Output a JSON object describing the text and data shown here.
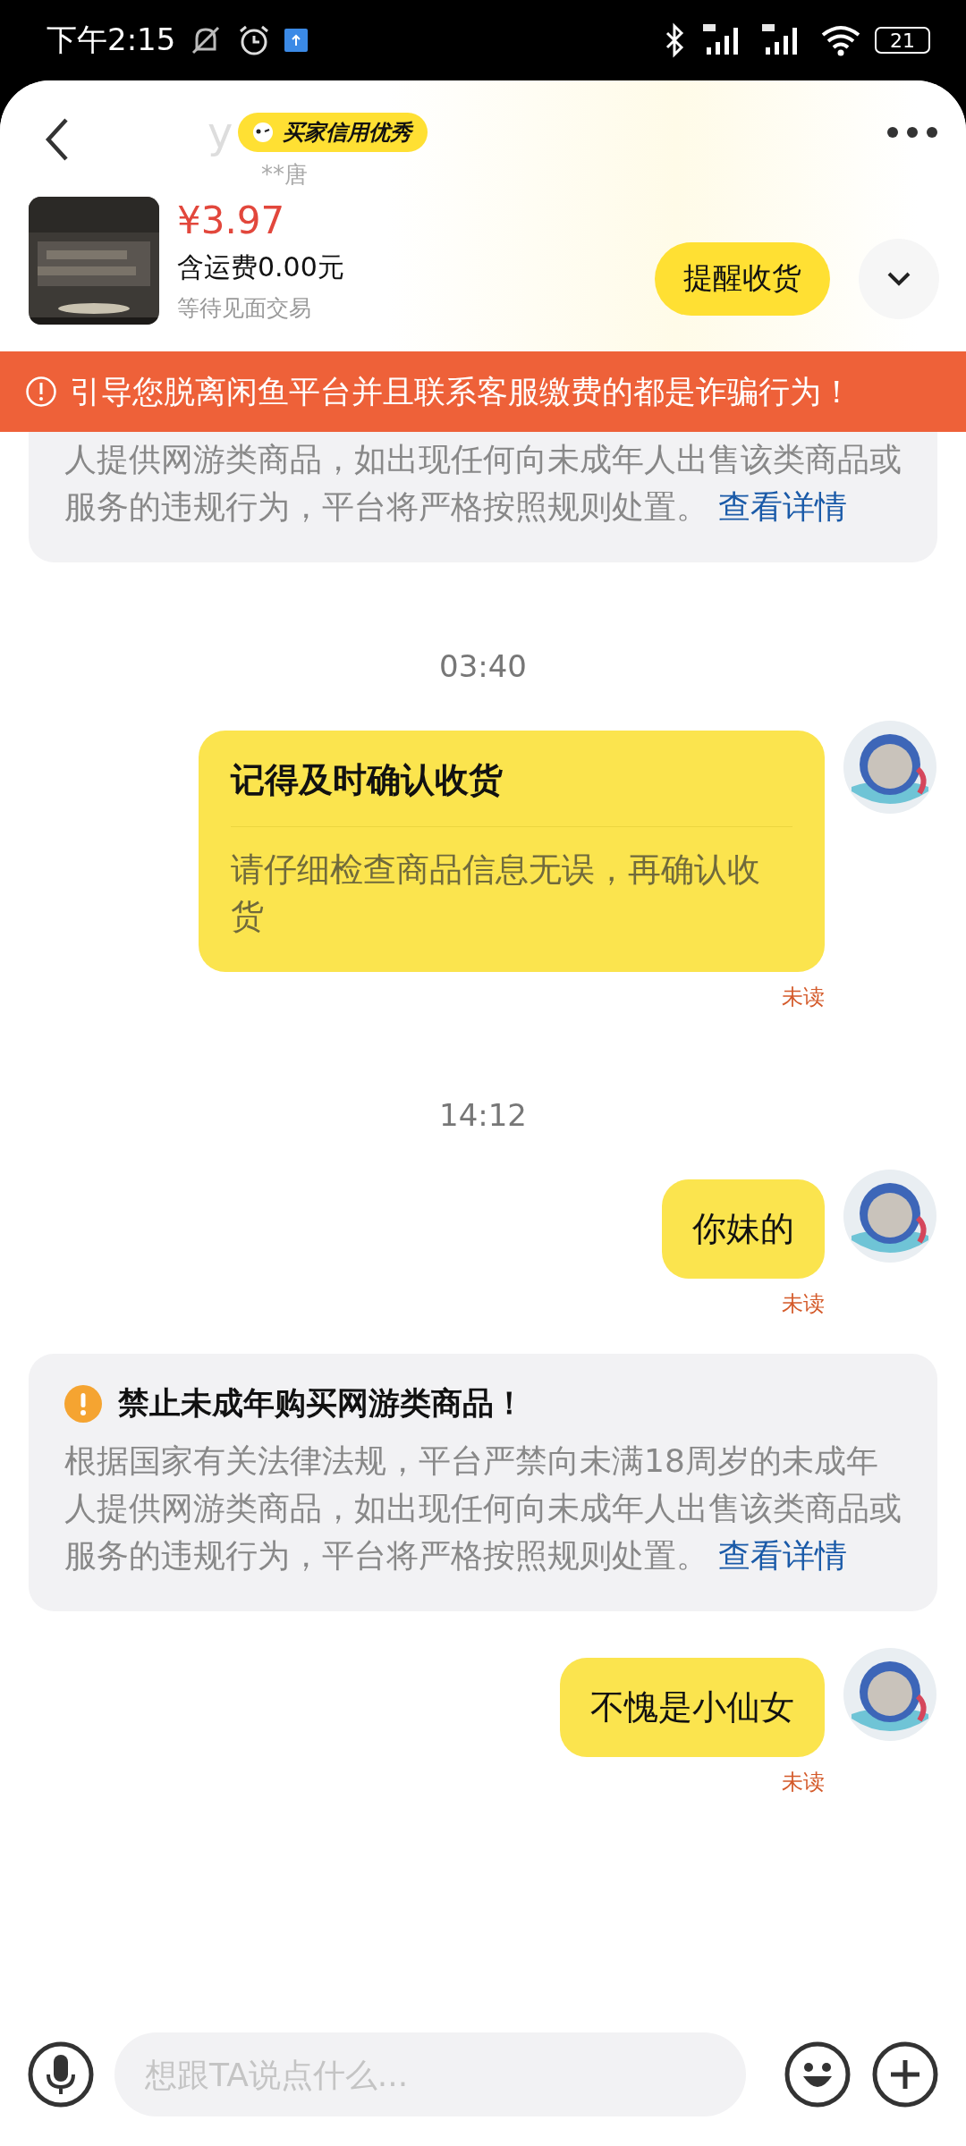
{
  "status_bar": {
    "time": "下午2:15",
    "battery": "21"
  },
  "header": {
    "title": "y",
    "badge": "买家信用优秀",
    "subtitle": "**唐"
  },
  "product": {
    "price": "¥3.97",
    "shipping": "含运费0.00元",
    "status": "等待见面交易",
    "action": "提醒收货"
  },
  "banner": {
    "text": "引导您脱离闲鱼平台并且联系客服缴费的都是诈骗行为！"
  },
  "messages": [
    {
      "kind": "notice",
      "body": "人提供网游类商品，如出现任何向未成年人出售该类商品或服务的违规行为，平台将严格按照规则处置。",
      "link": "查看详情"
    },
    {
      "kind": "time",
      "text": "03:40"
    },
    {
      "kind": "card",
      "title": "记得及时确认收货",
      "body": "请仔细检查商品信息无误，再确认收货",
      "status": "未读"
    },
    {
      "kind": "time",
      "text": "14:12"
    },
    {
      "kind": "text",
      "text": "你妹的",
      "status": "未读"
    },
    {
      "kind": "notice",
      "title": "禁止未成年购买网游类商品！",
      "body": "根据国家有关法律法规，平台严禁向未满18周岁的未成年人提供网游类商品，如出现任何向未成年人出售该类商品或服务的违规行为，平台将严格按照规则处置。",
      "link": "查看详情"
    },
    {
      "kind": "text",
      "text": "不愧是小仙女",
      "status": "未读"
    }
  ],
  "composer": {
    "placeholder": "想跟TA说点什么..."
  }
}
